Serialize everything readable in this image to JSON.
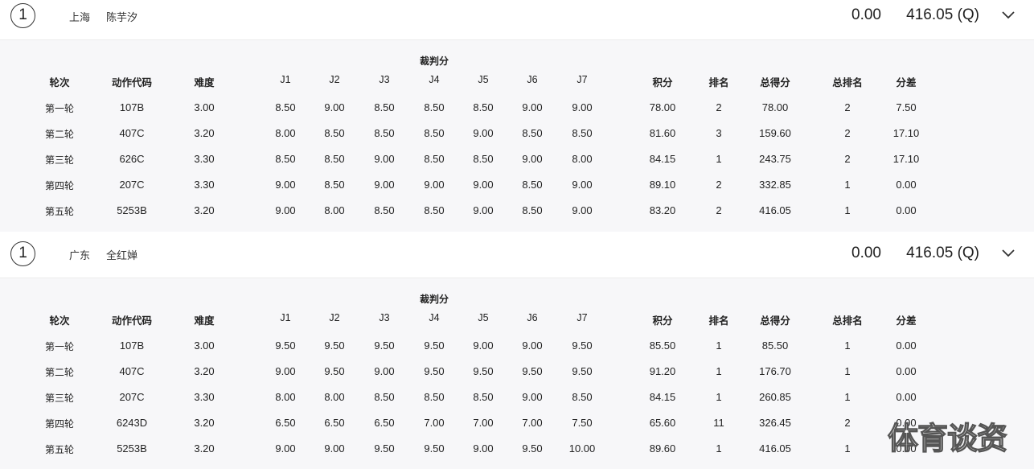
{
  "columns": [
    "轮次",
    "动作代码",
    "难度",
    "J1",
    "J2",
    "J3",
    "J4",
    "J5",
    "J6",
    "J7",
    "积分",
    "排名",
    "总得分",
    "总排名",
    "分差"
  ],
  "judge_group_label": "裁判分",
  "athletes": [
    {
      "rank": "1",
      "province": "上海",
      "name": "陈芋汐",
      "score_diff": "0.00",
      "total": "416.05 (Q)",
      "rounds": [
        [
          "第一轮",
          "107B",
          "3.00",
          "8.50",
          "9.00",
          "8.50",
          "8.50",
          "8.50",
          "9.00",
          "9.00",
          "78.00",
          "2",
          "78.00",
          "2",
          "7.50"
        ],
        [
          "第二轮",
          "407C",
          "3.20",
          "8.00",
          "8.50",
          "8.50",
          "8.50",
          "9.00",
          "8.50",
          "8.50",
          "81.60",
          "3",
          "159.60",
          "2",
          "17.10"
        ],
        [
          "第三轮",
          "626C",
          "3.30",
          "8.50",
          "8.50",
          "9.00",
          "8.50",
          "8.50",
          "9.00",
          "8.00",
          "84.15",
          "1",
          "243.75",
          "2",
          "17.10"
        ],
        [
          "第四轮",
          "207C",
          "3.30",
          "9.00",
          "8.50",
          "9.00",
          "9.00",
          "9.00",
          "8.50",
          "9.00",
          "89.10",
          "2",
          "332.85",
          "1",
          "0.00"
        ],
        [
          "第五轮",
          "5253B",
          "3.20",
          "9.00",
          "8.00",
          "8.50",
          "8.50",
          "9.00",
          "8.50",
          "9.00",
          "83.20",
          "2",
          "416.05",
          "1",
          "0.00"
        ]
      ]
    },
    {
      "rank": "1",
      "province": "广东",
      "name": "全红婵",
      "score_diff": "0.00",
      "total": "416.05 (Q)",
      "rounds": [
        [
          "第一轮",
          "107B",
          "3.00",
          "9.50",
          "9.50",
          "9.50",
          "9.50",
          "9.00",
          "9.00",
          "9.50",
          "85.50",
          "1",
          "85.50",
          "1",
          "0.00"
        ],
        [
          "第二轮",
          "407C",
          "3.20",
          "9.00",
          "9.50",
          "9.00",
          "9.50",
          "9.50",
          "9.50",
          "9.50",
          "91.20",
          "1",
          "176.70",
          "1",
          "0.00"
        ],
        [
          "第三轮",
          "207C",
          "3.30",
          "8.00",
          "8.00",
          "8.50",
          "8.50",
          "8.50",
          "9.00",
          "8.50",
          "84.15",
          "1",
          "260.85",
          "1",
          "0.00"
        ],
        [
          "第四轮",
          "6243D",
          "3.20",
          "6.50",
          "6.50",
          "6.50",
          "7.00",
          "7.00",
          "7.00",
          "7.50",
          "65.60",
          "11",
          "326.45",
          "2",
          "0.00"
        ],
        [
          "第五轮",
          "5253B",
          "3.20",
          "9.00",
          "9.00",
          "9.50",
          "9.50",
          "9.00",
          "9.50",
          "10.00",
          "89.60",
          "1",
          "416.05",
          "1",
          "0.00"
        ]
      ]
    }
  ],
  "watermark": "体育谈资",
  "icons": {
    "expand": "chevron-down-icon"
  }
}
